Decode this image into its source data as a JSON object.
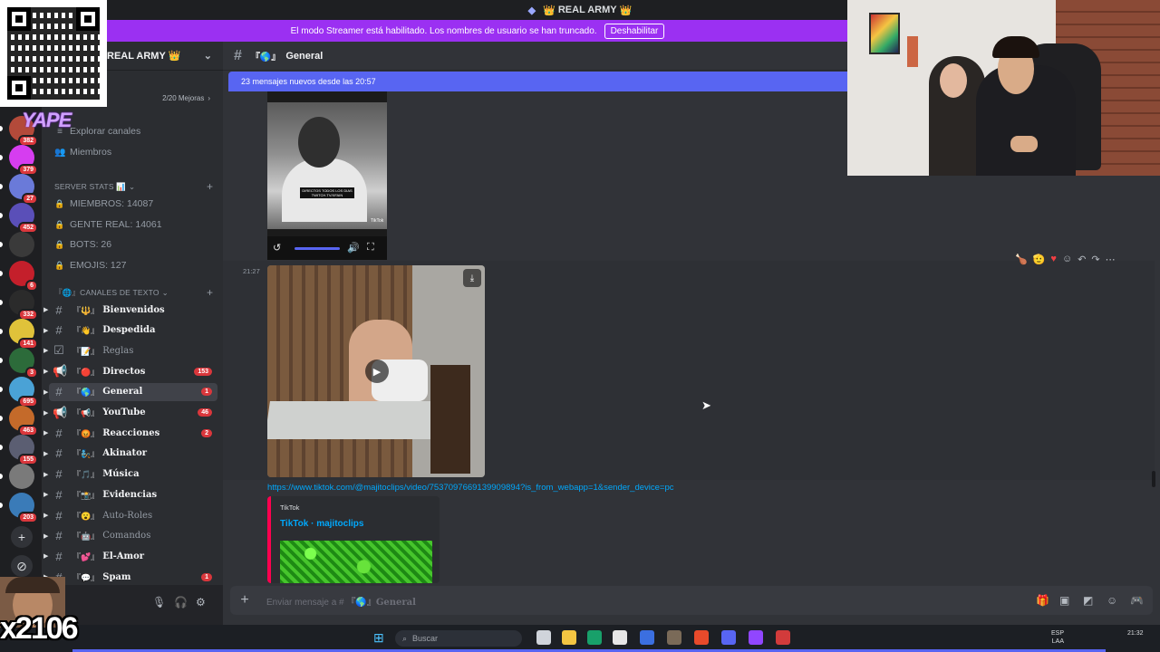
{
  "window": {
    "title": "REAL ARMY",
    "crown": "👑"
  },
  "banner": {
    "text": "El modo Streamer está habilitado. Los nombres de usuario se han truncado.",
    "button": "Deshabilitar"
  },
  "server": {
    "name": "REAL ARMY",
    "crown": "👑",
    "boost_label": "2/20 Mejoras",
    "boost_partial": "ras"
  },
  "rail": {
    "servers": [
      {
        "count": "382",
        "color": "#b34a3a"
      },
      {
        "count": "379",
        "color": "#d63df0"
      },
      {
        "count": "27",
        "color": "#6a7ad9"
      },
      {
        "count": "452",
        "color": "#5a4fb8"
      },
      {
        "count": "",
        "color": "#3a3a3a"
      },
      {
        "count": "6",
        "color": "#c41f2b"
      },
      {
        "count": "332",
        "color": "#2b2b2b"
      },
      {
        "count": "141",
        "color": "#e0c23a"
      },
      {
        "count": "3",
        "color": "#2c6b3a"
      },
      {
        "count": "695",
        "color": "#4aa2d6"
      },
      {
        "count": "463",
        "color": "#c46a2a"
      },
      {
        "count": "155",
        "color": "#5b5e72"
      },
      {
        "count": "",
        "color": "#7a7a7a"
      },
      {
        "count": "203",
        "color": "#3a7bb8"
      }
    ],
    "add_icon": "+",
    "discover_icon": "compass"
  },
  "nav": [
    {
      "label": "Explorar canales",
      "icon": "explore-icon"
    },
    {
      "label": "Miembros",
      "icon": "members-icon"
    }
  ],
  "stats_category": "SERVER STATS 📊",
  "stats": [
    {
      "label": "MIEMBROS: 14087"
    },
    {
      "label": "GENTE REAL: 14061"
    },
    {
      "label": "BOTS: 26"
    },
    {
      "label": "EMOJIS: 127"
    }
  ],
  "text_category": "『🌐』CANALES DE TEXTO",
  "channels": [
    {
      "emoji": "『🔱』",
      "name": "Bienvenidos",
      "bold": true,
      "type": "hash",
      "badge": ""
    },
    {
      "emoji": "『👋』",
      "name": "Despedida",
      "bold": true,
      "type": "hash",
      "badge": ""
    },
    {
      "emoji": "『📝』",
      "name": "Reglas",
      "bold": false,
      "type": "rules",
      "badge": ""
    },
    {
      "emoji": "『🔴』",
      "name": "Directos",
      "bold": true,
      "type": "announce",
      "badge": "153"
    },
    {
      "emoji": "『🌎』",
      "name": "General",
      "bold": true,
      "type": "hash",
      "badge": "1",
      "active": true
    },
    {
      "emoji": "『📢』",
      "name": "YouTube",
      "bold": true,
      "type": "announce",
      "badge": "46"
    },
    {
      "emoji": "『😡』",
      "name": "Reacciones",
      "bold": true,
      "type": "hash",
      "badge": "2"
    },
    {
      "emoji": "『🧞』",
      "name": "Akinator",
      "bold": true,
      "type": "hash",
      "badge": ""
    },
    {
      "emoji": "『🎵』",
      "name": "Música",
      "bold": true,
      "type": "hash",
      "badge": ""
    },
    {
      "emoji": "『📸』",
      "name": "Evidencias",
      "bold": true,
      "type": "hash",
      "badge": ""
    },
    {
      "emoji": "『😮』",
      "name": "Auto-Roles",
      "bold": false,
      "type": "hash",
      "badge": ""
    },
    {
      "emoji": "『🤖』",
      "name": "Comandos",
      "bold": false,
      "type": "hash",
      "badge": ""
    },
    {
      "emoji": "『💕』",
      "name": "El-Amor",
      "bold": true,
      "type": "hash",
      "badge": ""
    },
    {
      "emoji": "『💬』",
      "name": "Spam",
      "bold": true,
      "type": "hash",
      "badge": "1"
    }
  ],
  "chat": {
    "channel_emoji": "『🌎』",
    "channel_name": "General",
    "new_messages": "23 mensajes nuevos desde las 20:57",
    "video1_caption": "DIRECTOS TODOS LOS DIAS TWITCH.TV/XFAIN",
    "video1_brand": "TikTok",
    "message_time": "21:27",
    "link": "https://www.tiktok.com/@majitoclips/video/7537097669139909894?is_from_webapp=1&sender_device=pc",
    "embed_provider": "TikTok",
    "embed_title": "TikTok · majitoclips",
    "composer_placeholder": "Enviar mensaje a #",
    "composer_channel": "『🌎』General"
  },
  "taskbar": {
    "search": "Buscar",
    "lang": "ESP",
    "lang2": "LAA",
    "time": "21:32"
  },
  "overlay": {
    "promo": "YAPE",
    "counter": "x2106"
  },
  "colors": {
    "accent": "#5865f2",
    "streamer": "#9b30f2",
    "badge": "#da373c",
    "link": "#00a8fc"
  }
}
